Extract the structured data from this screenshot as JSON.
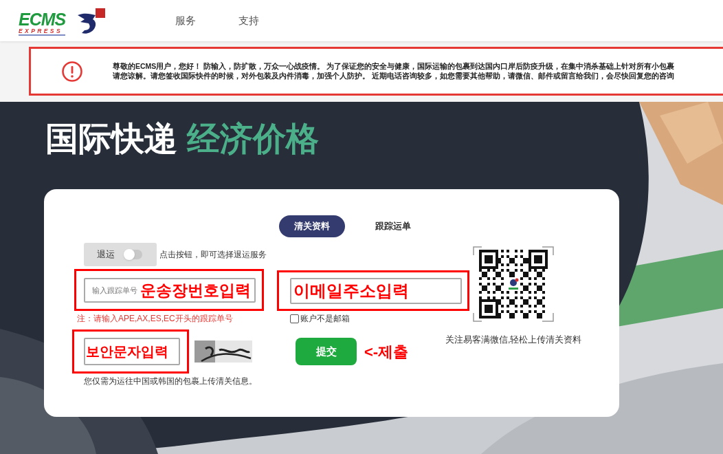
{
  "header": {
    "logo": {
      "name": "ECMS",
      "tagline": "EXPRESS"
    },
    "nav": [
      {
        "label": "服务"
      },
      {
        "label": "支持"
      }
    ]
  },
  "notice": {
    "lines": [
      "尊敬的ECMS用户，您好！ 防输入，防扩散，万众一心战疫情。 为了保证您的安全与健康，国际运输的包裹到达国内口岸后防疫升级，在集中消杀基础上针对所有小包裹",
      "请您谅解。请您签收国际快件的时候，对外包装及内件消毒，加强个人防护。 近期电话咨询较多，如您需要其他帮助，请微信、邮件或留言给我们，会尽快回复您的咨询"
    ]
  },
  "hero": {
    "title": "国际快递",
    "title_accent": "经济价格"
  },
  "form": {
    "tabs": [
      {
        "label": "清关资料",
        "selected": true
      },
      {
        "label": "跟踪运单",
        "selected": false
      }
    ],
    "return_toggle": {
      "label": "退运",
      "on": false,
      "hint": "点击按钮，即可选择退运服务"
    },
    "tracking_field": {
      "placeholder": "输入跟踪单号",
      "note": "注：请输入APE,AX,ES,EC开头的跟踪单号",
      "annotation": {
        "text": "운송장번호입력",
        "boxed": true
      }
    },
    "email_field": {
      "annotation": {
        "text": "이메일주소입력",
        "boxed": true
      },
      "checkbox": {
        "label": "账户不是邮箱",
        "checked": false
      }
    },
    "captcha_field": {
      "annotation": {
        "text": "보안문자입력",
        "boxed": true
      },
      "footnote": "您仅需为运往中国或韩国的包裹上传清关信息。"
    },
    "submit": {
      "label": "提交",
      "annotation": {
        "text": "<-제출",
        "boxed": false
      }
    },
    "qr": {
      "caption": "关注易客满微信,轻松上传清关资料"
    }
  }
}
